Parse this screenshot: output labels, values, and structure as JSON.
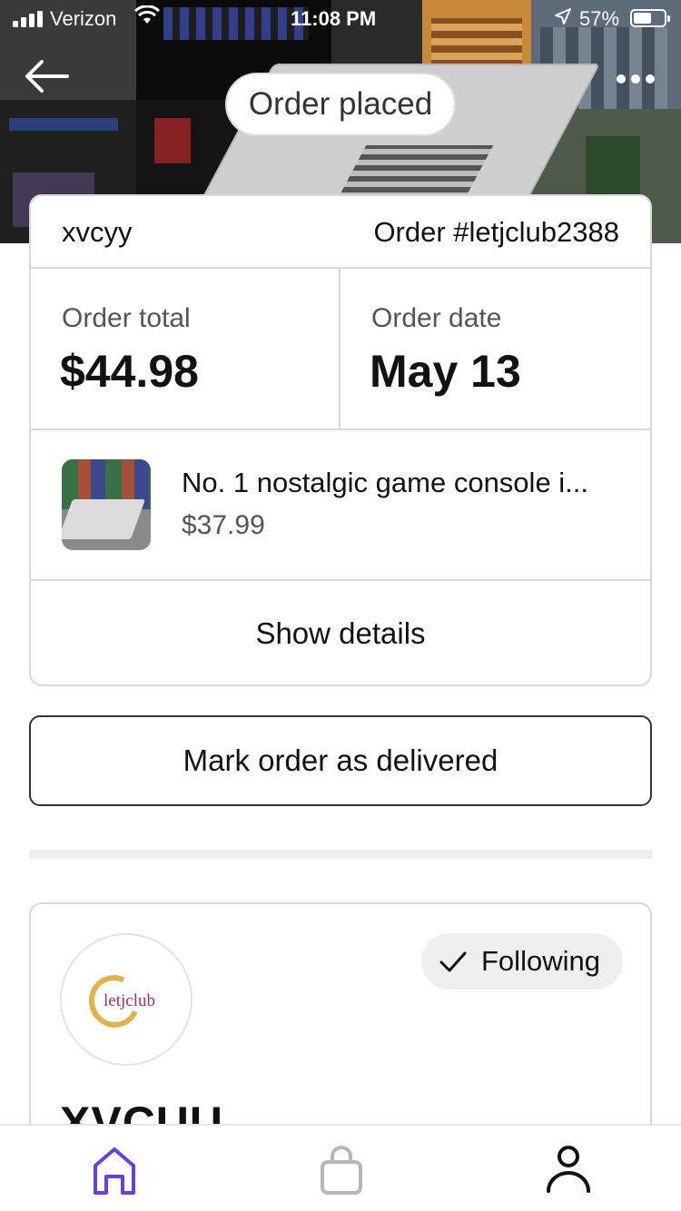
{
  "status_bar": {
    "carrier": "Verizon",
    "time": "11:08 PM",
    "battery": "57%"
  },
  "header": {
    "title": "Order placed"
  },
  "order": {
    "shop_name": "xvcyy",
    "order_number": "Order #letjclub2388",
    "total_label": "Order total",
    "total_value": "$44.98",
    "date_label": "Order date",
    "date_value": "May 13",
    "item": {
      "title": "No. 1 nostalgic game console i...",
      "price": "$37.99"
    },
    "show_details_label": "Show details"
  },
  "actions": {
    "mark_delivered_label": "Mark order as delivered"
  },
  "shop_card": {
    "logo_text": "letjclub",
    "following_label": "Following",
    "heading": "XVCUU"
  },
  "tab_bar": {
    "items": [
      "home",
      "bag",
      "profile"
    ],
    "active": "home"
  },
  "colors": {
    "accent": "#6a3de8",
    "inactive_icon": "#b7b7b7",
    "logo_gold": "#e0b24a",
    "logo_text": "#a0326a"
  },
  "icons": {
    "back": "arrow-left-icon",
    "more": "more-horizontal-icon",
    "check": "check-icon",
    "home": "home-icon",
    "bag": "bag-icon",
    "profile": "person-icon"
  }
}
